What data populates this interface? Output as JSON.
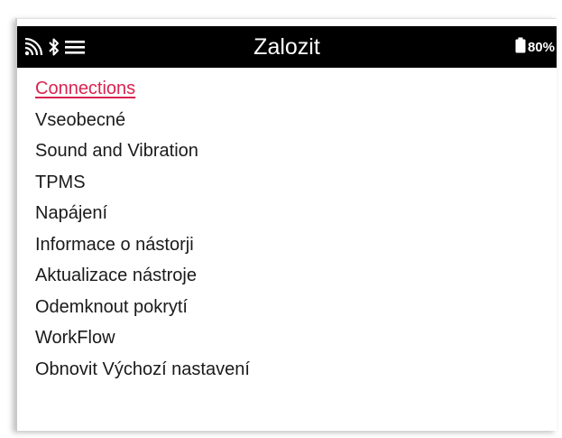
{
  "header": {
    "title": "Zalozit",
    "battery_text": "80%",
    "icons": [
      "signal-icon",
      "bluetooth-icon",
      "menu-icon",
      "battery-icon"
    ]
  },
  "menu": {
    "items": [
      {
        "label": "Connections",
        "selected": true
      },
      {
        "label": "Vseobecné",
        "selected": false
      },
      {
        "label": "Sound and Vibration",
        "selected": false
      },
      {
        "label": "TPMS",
        "selected": false
      },
      {
        "label": "Napájení",
        "selected": false
      },
      {
        "label": "Informace o nástorji",
        "selected": false
      },
      {
        "label": "Aktualizace nástroje",
        "selected": false
      },
      {
        "label": "Odemknout pokrytí",
        "selected": false
      },
      {
        "label": "WorkFlow",
        "selected": false
      },
      {
        "label": "Obnovit Výchozí nastavení",
        "selected": false
      }
    ]
  },
  "colors": {
    "status_bar_bg": "#000000",
    "status_bar_text": "#ffffff",
    "selected_item": "#d9234f",
    "item_text": "#1a1a1a"
  }
}
